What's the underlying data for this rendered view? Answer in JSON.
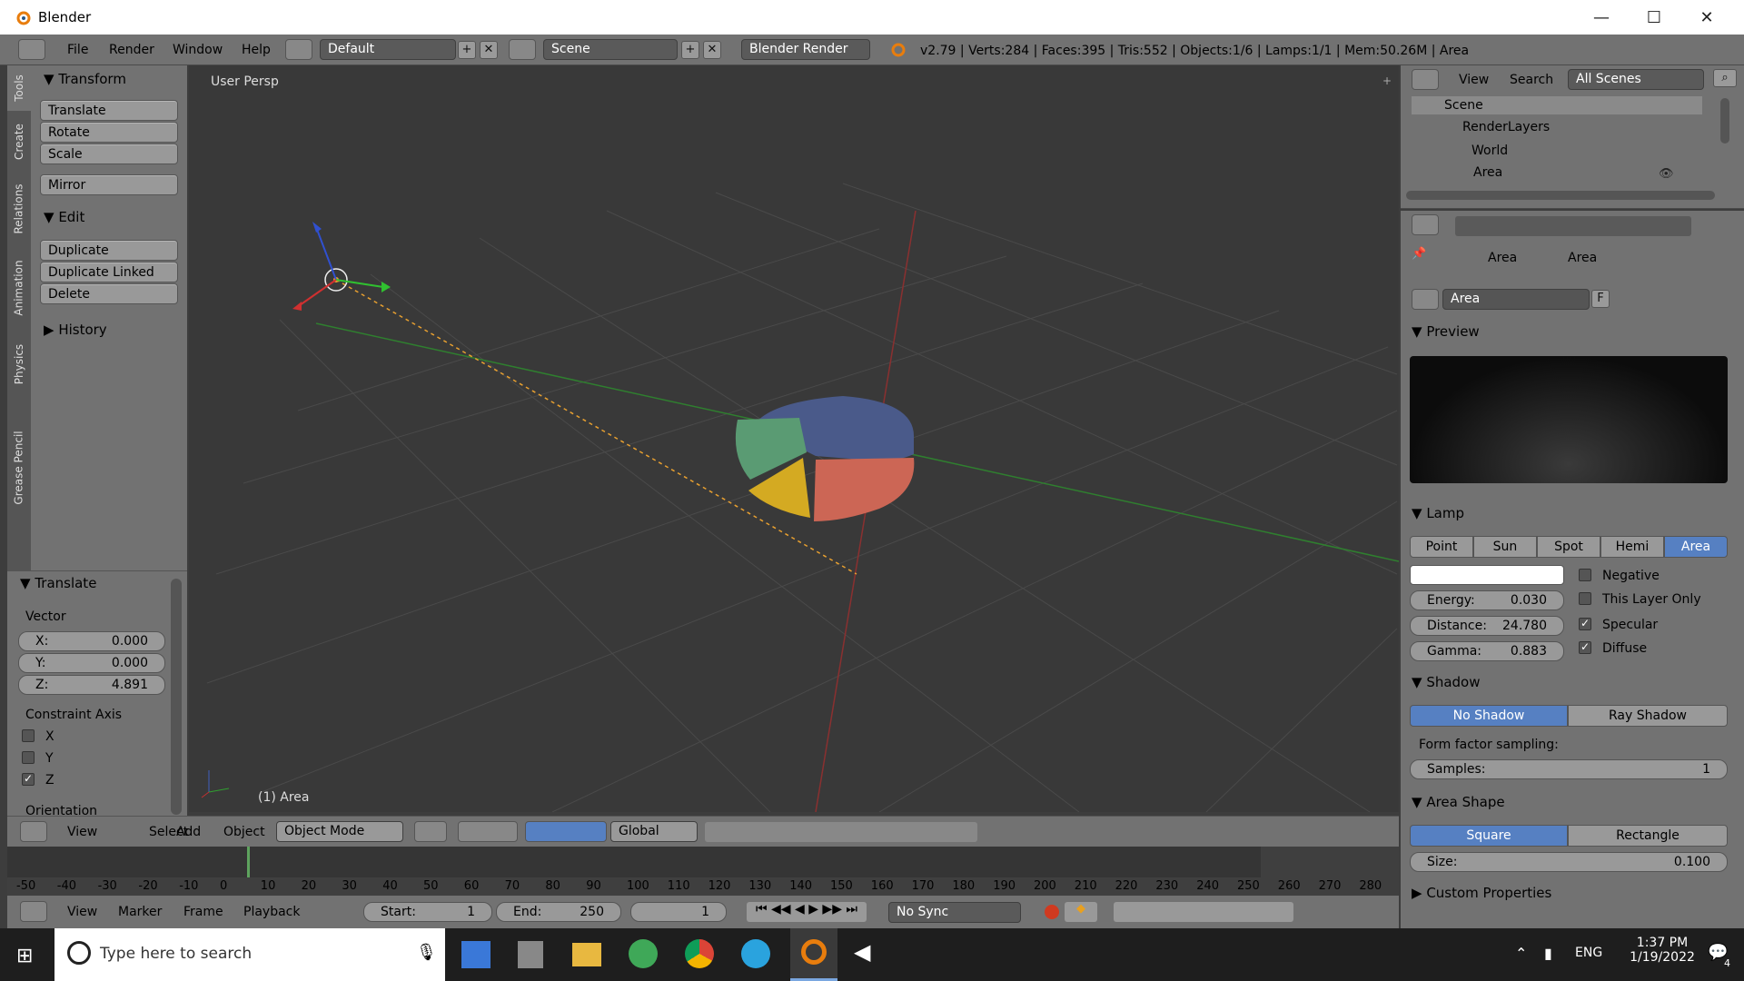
{
  "window": {
    "title": "Blender"
  },
  "topbar": {
    "menus": [
      "File",
      "Render",
      "Window",
      "Help"
    ],
    "layout": "Default",
    "scene": "Scene",
    "engine": "Blender Render",
    "status": "v2.79 | Verts:284 | Faces:395 | Tris:552 | Objects:1/6 | Lamps:1/1 | Mem:50.26M | Area"
  },
  "tabs": [
    "Tools",
    "Create",
    "Relations",
    "Animation",
    "Physics",
    "Grease Pencil"
  ],
  "toolshelf": {
    "transform_title": "Transform",
    "transform_buttons": [
      "Translate",
      "Rotate",
      "Scale"
    ],
    "mirror": "Mirror",
    "edit_title": "Edit",
    "edit_buttons": [
      "Duplicate",
      "Duplicate Linked",
      "Delete"
    ],
    "history_title": "History"
  },
  "operator": {
    "title": "Translate",
    "vector_label": "Vector",
    "fields": [
      {
        "label": "X:",
        "value": "0.000"
      },
      {
        "label": "Y:",
        "value": "0.000"
      },
      {
        "label": "Z:",
        "value": "4.891"
      }
    ],
    "constraint_label": "Constraint Axis",
    "axes": [
      {
        "label": "X",
        "checked": false
      },
      {
        "label": "Y",
        "checked": false
      },
      {
        "label": "Z",
        "checked": true
      }
    ],
    "orientation_label": "Orientation"
  },
  "viewport": {
    "label": "User Persp",
    "object_label": "(1) Area"
  },
  "outliner": {
    "view": "View",
    "search": "Search",
    "scenes": "All Scenes",
    "items": [
      "Scene",
      "RenderLayers",
      "World",
      "Area"
    ]
  },
  "properties": {
    "breadcrumb": [
      "Area",
      "Area"
    ],
    "datablock": "Area",
    "datablock_f": "F",
    "preview_title": "Preview",
    "lamp_title": "Lamp",
    "lamp_types": [
      "Point",
      "Sun",
      "Spot",
      "Hemi",
      "Area"
    ],
    "lamp_selected": "Area",
    "fields": [
      {
        "label": "Energy:",
        "value": "0.030"
      },
      {
        "label": "Distance:",
        "value": "24.780"
      },
      {
        "label": "Gamma:",
        "value": "0.883"
      }
    ],
    "options": [
      {
        "label": "Negative",
        "checked": false
      },
      {
        "label": "This Layer Only",
        "checked": false
      },
      {
        "label": "Specular",
        "checked": true
      },
      {
        "label": "Diffuse",
        "checked": true
      }
    ],
    "shadow_title": "Shadow",
    "shadow_types": [
      "No Shadow",
      "Ray Shadow"
    ],
    "form_factor": "Form factor sampling:",
    "samples_label": "Samples:",
    "samples_value": "1",
    "area_shape_title": "Area Shape",
    "shapes": [
      "Square",
      "Rectangle"
    ],
    "size_label": "Size:",
    "size_value": "0.100",
    "custom_title": "Custom Properties"
  },
  "vpheader": {
    "menus": [
      "View",
      "Select",
      "Add",
      "Object"
    ],
    "mode": "Object Mode",
    "orientation": "Global"
  },
  "timeline": {
    "ticks": [
      "-50",
      "-40",
      "-30",
      "-20",
      "-10",
      "0",
      "10",
      "20",
      "30",
      "40",
      "50",
      "60",
      "70",
      "80",
      "90",
      "100",
      "110",
      "120",
      "130",
      "140",
      "150",
      "160",
      "170",
      "180",
      "190",
      "200",
      "210",
      "220",
      "230",
      "240",
      "250",
      "260",
      "270",
      "280"
    ]
  },
  "tlheader": {
    "menus": [
      "View",
      "Marker",
      "Frame",
      "Playback"
    ],
    "start_label": "Start:",
    "start": "1",
    "end_label": "End:",
    "end": "250",
    "current": "1",
    "sync": "No Sync"
  },
  "taskbar": {
    "search": "Type here to search",
    "lang": "ENG",
    "time": "1:37 PM",
    "date": "1/19/2022",
    "notif": "4"
  },
  "colors": {
    "accent": "#5680c2",
    "pie_blue": "#4a5a8a",
    "pie_red": "#cc6655",
    "pie_green": "#5a9b73",
    "pie_yellow": "#d4aa22"
  }
}
